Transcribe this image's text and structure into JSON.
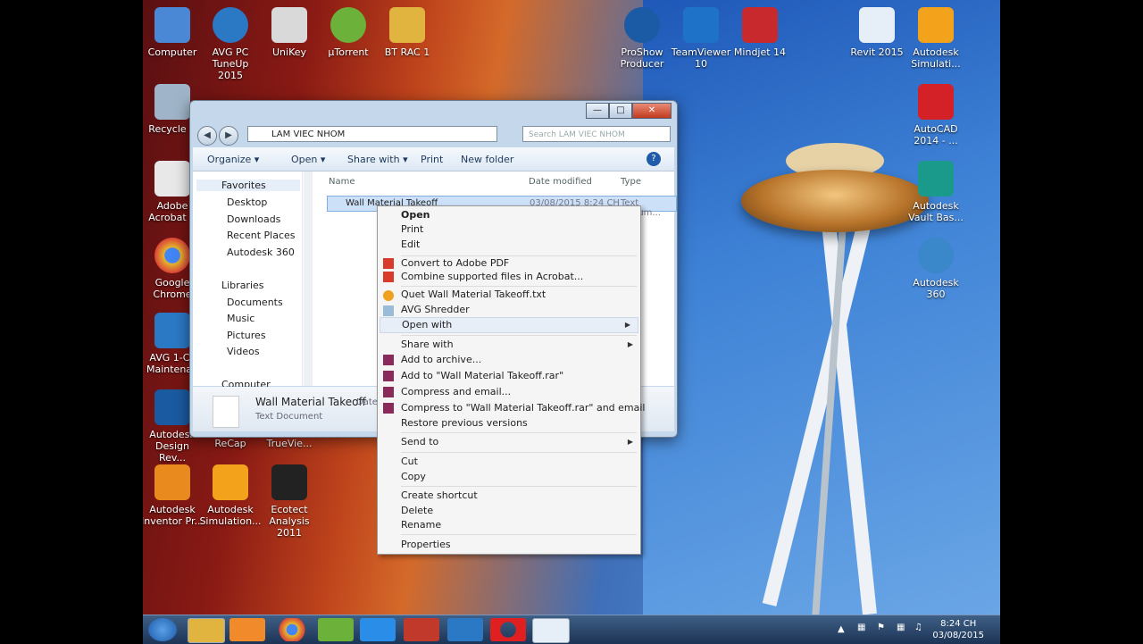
{
  "desktop_icons": [
    {
      "label": "Computer",
      "color": "#4a87d4"
    },
    {
      "label": "AVG PC\nTuneUp 2015",
      "color": "#2b78c4"
    },
    {
      "label": "UniKey",
      "color": "#d9d9d9"
    },
    {
      "label": "µTorrent",
      "color": "#6cb23a"
    },
    {
      "label": "BT RAC 1",
      "color": "#e0b43e"
    },
    {
      "label": "ProShow\nProducer",
      "color": "#1b5aa5"
    },
    {
      "label": "TeamViewer\n10",
      "color": "#1e73c8"
    },
    {
      "label": "Mindjet 14",
      "color": "#c8292d"
    },
    {
      "label": "Revit 2015",
      "color": "#e6eef8"
    },
    {
      "label": "Autodesk\nSimulati...",
      "color": "#f3a21b"
    },
    {
      "label": "Recycle B",
      "color": "#9fb4c8"
    },
    {
      "label": "AutoCAD\n2014 - ...",
      "color": "#d42027"
    },
    {
      "label": "Adobe\nAcrobat X",
      "color": "#e8e8e8"
    },
    {
      "label": "Autodesk\nVault Bas...",
      "color": "#1a9a8a"
    },
    {
      "label": "Google\nChrome",
      "color": "#e4b62e"
    },
    {
      "label": "Autodesk 360",
      "color": "#3a87c9"
    },
    {
      "label": "AVG 1-Cli\nMaintenan",
      "color": "#2b78c4"
    },
    {
      "label": "Autodesk\nDesign Rev...",
      "color": "#1a5aa0"
    },
    {
      "label": "ReCap",
      "color": "#6c6c6c"
    },
    {
      "label": "TrueVie...",
      "color": "#6c6c6c"
    },
    {
      "label": "Autodesk\nInventor Pr...",
      "color": "#e98a1e"
    },
    {
      "label": "Autodesk\nSimulation...",
      "color": "#f3a21b"
    },
    {
      "label": "Ecotect\nAnalysis 2011",
      "color": "#222222"
    }
  ],
  "explorer": {
    "address": "LAM VIEC NHOM",
    "search_placeholder": "Search LAM VIEC NHOM",
    "toolbar": {
      "organize": "Organize ▾",
      "open": "Open ▾",
      "share_with": "Share with ▾",
      "print": "Print",
      "new_folder": "New folder"
    },
    "nav": {
      "favorites": "Favorites",
      "desktop": "Desktop",
      "downloads": "Downloads",
      "recent_places": "Recent Places",
      "autodesk360": "Autodesk 360",
      "libraries": "Libraries",
      "documents": "Documents",
      "music": "Music",
      "pictures": "Pictures",
      "videos": "Videos",
      "computer": "Computer"
    },
    "columns": {
      "name": "Name",
      "date_modified": "Date modified",
      "type": "Type"
    },
    "file": {
      "name": "Wall Material Takeoff",
      "date": "03/08/2015 8:24 CH",
      "type": "Text Docum..."
    },
    "details": {
      "name": "Wall Material Takeoff",
      "date_label": "Date",
      "type": "Text Document"
    }
  },
  "context_menu": {
    "open": "Open",
    "print": "Print",
    "edit": "Edit",
    "convert_pdf": "Convert to Adobe PDF",
    "combine_acrobat": "Combine supported files in Acrobat...",
    "quet": "Quet Wall Material Takeoff.txt",
    "avg_shredder": "AVG Shredder",
    "open_with": "Open with",
    "share_with": "Share with",
    "add_archive": "Add to archive...",
    "add_rar": "Add to \"Wall Material Takeoff.rar\"",
    "compress_email": "Compress and email...",
    "compress_rar_email": "Compress to \"Wall Material Takeoff.rar\" and email",
    "restore": "Restore previous versions",
    "send_to": "Send to",
    "cut": "Cut",
    "copy": "Copy",
    "create_shortcut": "Create shortcut",
    "delete": "Delete",
    "rename": "Rename",
    "properties": "Properties"
  },
  "taskbar": {
    "time": "8:24 CH",
    "date": "03/08/2015"
  }
}
